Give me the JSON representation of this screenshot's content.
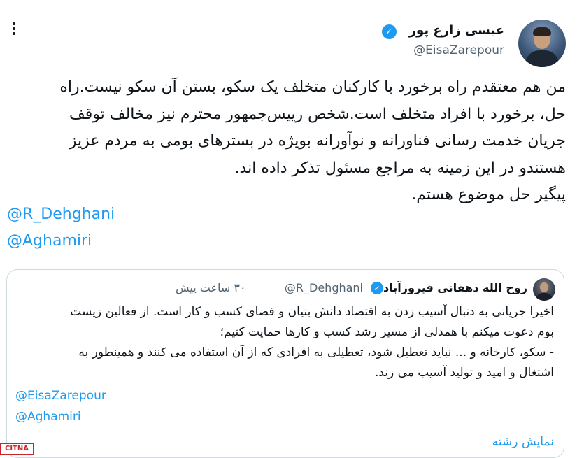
{
  "tweet": {
    "author_name": "عیسی زارع پور",
    "verified_icon": "verified-check-icon",
    "author_handle": "@EisaZarepour",
    "text": "من هم معتقدم راه برخورد با کارکنان متخلف یک سکو، بستن آن سکو نیست.راه\nحل، برخورد با افراد متخلف است.شخص رییس‌جمهور محترم نیز مخالف توقف\nجریان خدمت رسانی فناورانه و نوآورانه بویژه در بسترهای بومی به مردم عزیز\nهستندو در این زمینه به مراجع مسئول تذکر داده اند.\nپیگیر حل موضوع هستم.",
    "mentions": [
      "@R_Dehghani",
      "@Aghamiri"
    ]
  },
  "quoted_tweet": {
    "author_name": "روح الله دهقانی فیروزآبادی",
    "author_handle": "@R_Dehghani",
    "time": "۳۰ ساعت پیش",
    "text": "اخیرا جریانی به دنبال آسیب زدن به اقتصاد دانش بنیان و فضای کسب و کار است. از فعالین زیست\nبوم دعوت میکنم با همدلی از مسیر رشد کسب و کارها حمایت کنیم؛\n- سکو، کارخانه و ... نباید تعطیل شود، تعطیلی به افرادی که از آن استفاده می کنند و همینطور به\nاشتغال و امید و تولید آسیب می زند.",
    "mentions": [
      "@EisaZarepour",
      "@Aghamiri"
    ],
    "show_thread_label": "نمایش رشته"
  },
  "watermark_text": "CITNA",
  "colors": {
    "link": "#1d9bf0",
    "text": "#0f1419",
    "secondary": "#536471",
    "border": "#cfd9de",
    "watermark": "#c9252b"
  }
}
